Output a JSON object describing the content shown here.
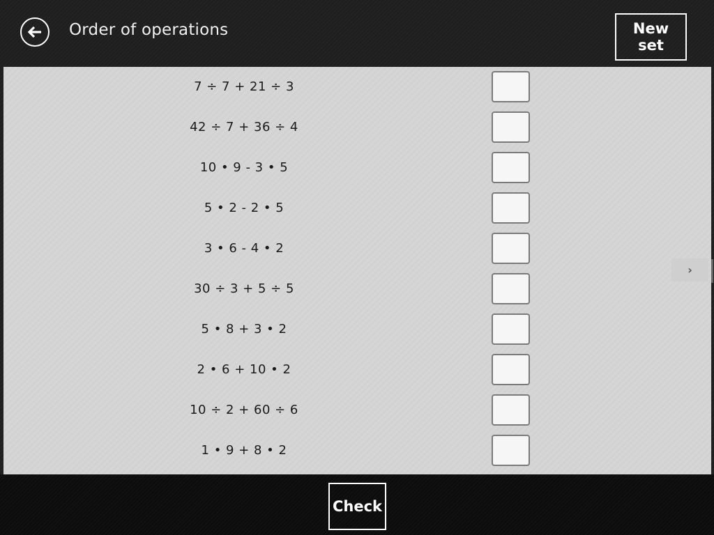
{
  "header": {
    "back_icon": "arrow-left-icon",
    "title": "Order of operations",
    "new_set_label": "New set"
  },
  "problems": [
    {
      "expression": "7 ÷ 7 + 21 ÷ 3",
      "answer": ""
    },
    {
      "expression": "42 ÷ 7 + 36 ÷ 4",
      "answer": ""
    },
    {
      "expression": "10 • 9 - 3 • 5",
      "answer": ""
    },
    {
      "expression": "5 • 2 - 2 • 5",
      "answer": ""
    },
    {
      "expression": "3 • 6 - 4 • 2",
      "answer": ""
    },
    {
      "expression": "30 ÷ 3 + 5 ÷ 5",
      "answer": ""
    },
    {
      "expression": "5 • 8 + 3 • 2",
      "answer": ""
    },
    {
      "expression": "2 • 6 + 10 • 2",
      "answer": ""
    },
    {
      "expression": "10 ÷ 2 + 60 ÷ 6",
      "answer": ""
    },
    {
      "expression": "1 • 9 + 8 • 2",
      "answer": ""
    }
  ],
  "navigation": {
    "next_icon": "chevron-right-icon",
    "next_glyph": "›"
  },
  "footer": {
    "check_label": "Check"
  }
}
